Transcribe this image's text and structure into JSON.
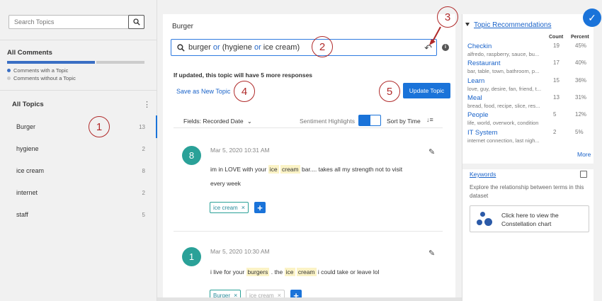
{
  "sidebar": {
    "search_placeholder": "Search Topics",
    "all_comments_title": "All Comments",
    "legend_with": "Comments with a Topic",
    "legend_without": "Comments without a Topic",
    "all_topics_title": "All Topics",
    "topics": [
      {
        "name": "Burger",
        "count": "13"
      },
      {
        "name": "hygiene",
        "count": "2"
      },
      {
        "name": "ice cream",
        "count": "8"
      },
      {
        "name": "internet",
        "count": "2"
      },
      {
        "name": "staff",
        "count": "5"
      }
    ]
  },
  "callouts": [
    "1",
    "2",
    "3",
    "4",
    "5"
  ],
  "main": {
    "title": "Burger",
    "query": {
      "t1": "burger ",
      "k1": "or",
      "t2": " (hygiene ",
      "k2": "or",
      "t3": " ice cream)"
    },
    "update_note": "If updated, this topic will have 5 more responses",
    "save_new_label": "Save as New Topic",
    "update_label": "Update Topic",
    "fields_label": "Fields: Recorded Date",
    "sentiment_label": "Sentiment Highlights",
    "sort_label": "Sort by Time",
    "comments": [
      {
        "avatar": "8",
        "timestamp": "Mar 5, 2020 10:31 AM",
        "l1a": "im in LOVE with your ",
        "l1h1": "ice",
        "l1b": " ",
        "l1h2": "cream",
        "l1c": " bar.... takes all my strength not to visit",
        "l2": "every week",
        "tag": "ice cream"
      },
      {
        "avatar": "1",
        "timestamp": "Mar 5, 2020 10:30 AM",
        "l1a": "i live for your ",
        "l1h1": "burgers",
        "l1b": " . the ",
        "l1h2": "ice",
        "l1c": " ",
        "l1h3": "cream",
        "l1d": " i could take or leave lol",
        "tag1": "Burger",
        "tag2": "ice cream"
      }
    ]
  },
  "recommendations": {
    "title": "Topic Recommendations",
    "count_head": "Count",
    "percent_head": "Percent",
    "items": [
      {
        "name": "Checkin",
        "sub": "alfredo, raspberry, sauce, bu...",
        "count": "19",
        "pct": "45%"
      },
      {
        "name": "Restaurant",
        "sub": "bar, table, town, bathroom, p...",
        "count": "17",
        "pct": "40%"
      },
      {
        "name": "Learn",
        "sub": "love, guy, desire, fan, friend, t...",
        "count": "15",
        "pct": "36%"
      },
      {
        "name": "Meal",
        "sub": "bread, food, recipe, slice, res...",
        "count": "13",
        "pct": "31%"
      },
      {
        "name": "People",
        "sub": "life, world, overwork, condition",
        "count": "5",
        "pct": "12%"
      },
      {
        "name": "IT System",
        "sub": "internet connection, last nigh...",
        "count": "2",
        "pct": "5%"
      }
    ],
    "more_label": "More"
  },
  "keywords": {
    "title": "Keywords",
    "desc": "Explore the relationship between terms in this dataset",
    "constellation_label": "Click here to view the Constellation chart"
  },
  "colors": {
    "accent": "#1a73d9",
    "callout": "#b02a2a",
    "avatar": "#2aa198"
  }
}
